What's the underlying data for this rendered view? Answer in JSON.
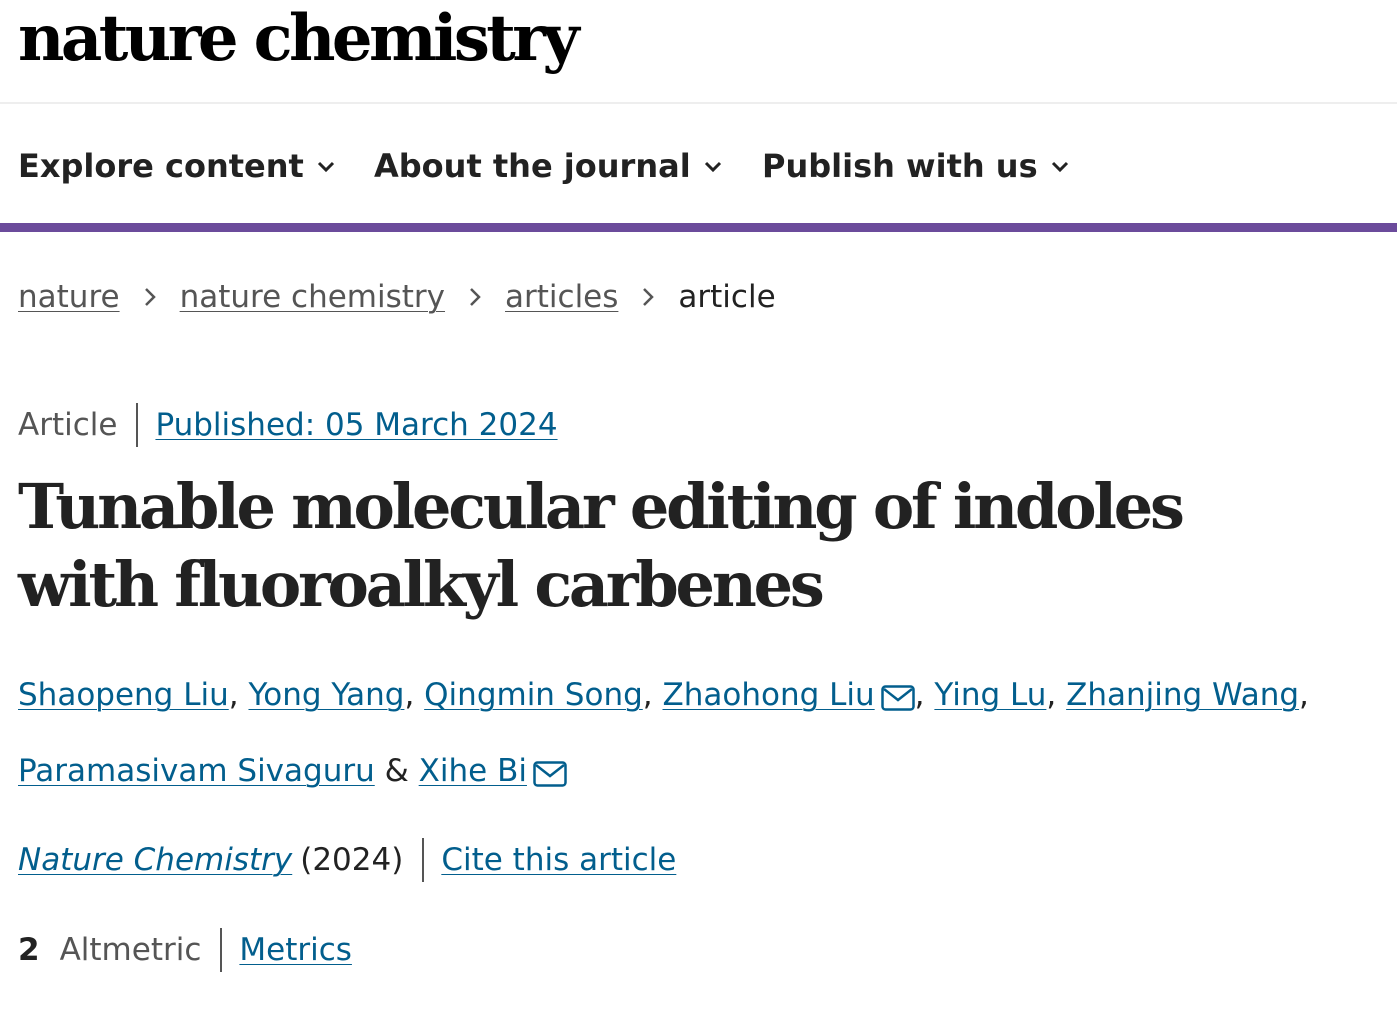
{
  "header": {
    "brand": "nature chemistry"
  },
  "nav": {
    "items": [
      {
        "label": "Explore content",
        "icon": "chevron-down-icon"
      },
      {
        "label": "About the journal",
        "icon": "chevron-down-icon"
      },
      {
        "label": "Publish with us",
        "icon": "chevron-down-icon"
      }
    ]
  },
  "breadcrumb": {
    "items": [
      "nature",
      "nature chemistry",
      "articles"
    ],
    "current": "article",
    "separator_icon": "chevron-right-icon"
  },
  "article": {
    "type": "Article",
    "published": "Published: 05 March 2024",
    "title": "Tunable molecular editing of indoles with fluoroalkyl carbenes",
    "authors": [
      {
        "name": "Shaopeng Liu"
      },
      {
        "name": "Yong Yang"
      },
      {
        "name": "Qingmin Song"
      },
      {
        "name": "Zhaohong Liu",
        "corresponding": true
      },
      {
        "name": "Ying Lu"
      },
      {
        "name": "Zhanjing Wang"
      },
      {
        "name": "Paramasivam Sivaguru"
      },
      {
        "name": "Xihe Bi",
        "corresponding": true
      }
    ],
    "author_separator": ",",
    "author_last_joiner": "&",
    "mail_icon": "mail-icon",
    "journal": "Nature Chemistry",
    "year": "(2024)",
    "cite_label": "Cite this article",
    "altmetric_count": "2",
    "altmetric_label": "Altmetric",
    "metrics_label": "Metrics"
  },
  "colors": {
    "link": "#025e8d",
    "nav_bar": "#6b4b9b",
    "text": "#222222",
    "muted": "#555555"
  }
}
